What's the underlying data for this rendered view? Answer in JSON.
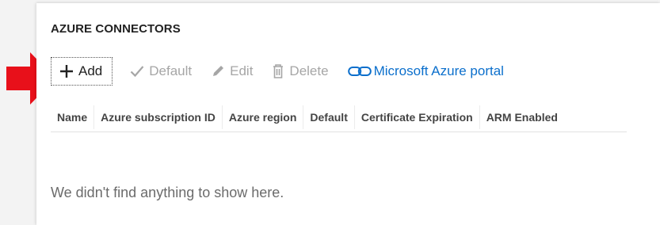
{
  "section": {
    "title": "AZURE CONNECTORS"
  },
  "toolbar": {
    "add": {
      "label": "Add",
      "icon": "plus-icon"
    },
    "default": {
      "label": "Default",
      "icon": "checkmark-icon"
    },
    "edit": {
      "label": "Edit",
      "icon": "pencil-icon"
    },
    "delete": {
      "label": "Delete",
      "icon": "trash-icon"
    },
    "portal": {
      "label": "Microsoft Azure portal",
      "icon": "link-icon"
    }
  },
  "table": {
    "columns": [
      "Name",
      "Azure subscription ID",
      "Azure region",
      "Default",
      "Certificate Expiration",
      "ARM Enabled"
    ],
    "empty_message": "We didn't find anything to show here."
  },
  "colors": {
    "accent_link": "#0b6fcc",
    "disabled": "#a6a6a6",
    "annotation_arrow": "#e8101a"
  }
}
